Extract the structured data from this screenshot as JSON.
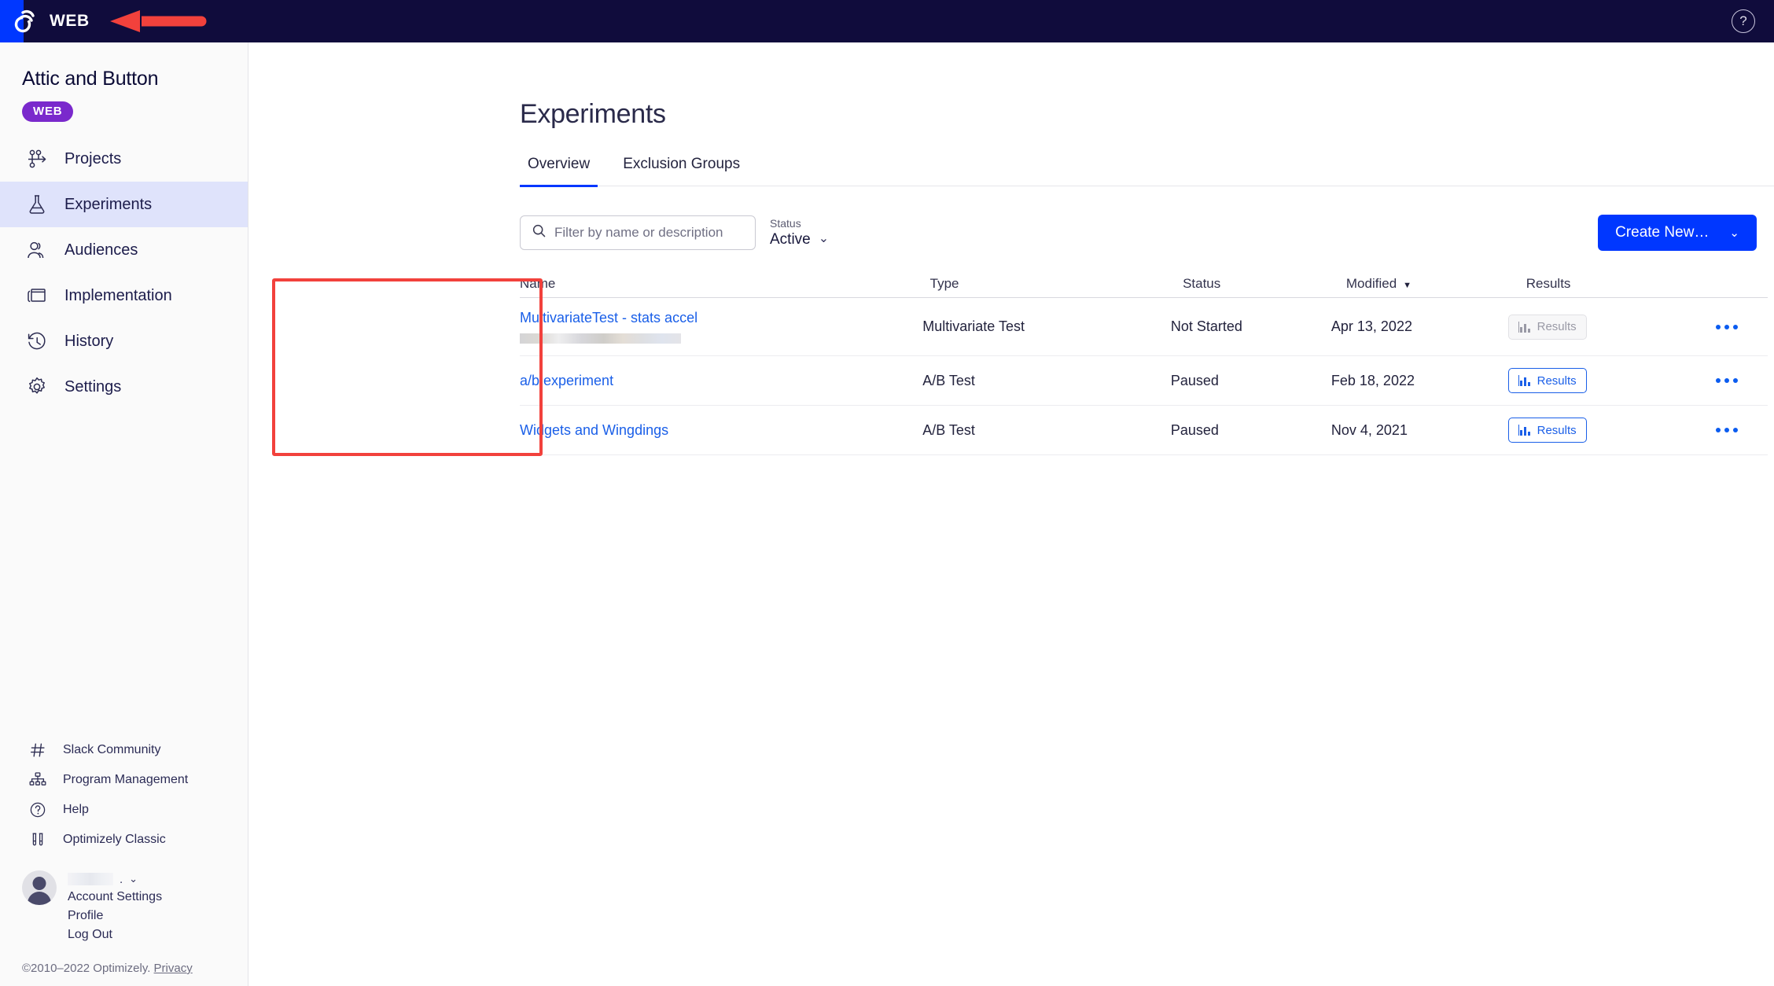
{
  "topbar": {
    "title": "WEB",
    "help_icon": "question-mark-circle-icon"
  },
  "sidebar": {
    "org_name": "Attic and Button",
    "badge": "WEB",
    "nav_items": [
      {
        "label": "Projects",
        "icon": "projects-branch-icon",
        "active": false
      },
      {
        "label": "Experiments",
        "icon": "flask-icon",
        "active": true
      },
      {
        "label": "Audiences",
        "icon": "people-icon",
        "active": false
      },
      {
        "label": "Implementation",
        "icon": "book-icon",
        "active": false
      },
      {
        "label": "History",
        "icon": "clock-undo-icon",
        "active": false
      },
      {
        "label": "Settings",
        "icon": "gear-icon",
        "active": false
      }
    ],
    "utility_items": [
      {
        "label": "Slack Community",
        "icon": "hash-icon"
      },
      {
        "label": "Program Management",
        "icon": "org-chart-icon"
      },
      {
        "label": "Help",
        "icon": "question-mark-circle-icon"
      },
      {
        "label": "Optimizely Classic",
        "icon": "test-tubes-icon"
      }
    ],
    "account": {
      "name_redacted": "",
      "name_suffix": ".",
      "links": [
        "Account Settings",
        "Profile",
        "Log Out"
      ]
    },
    "footer": {
      "copyright": "©2010–2022 Optimizely.",
      "privacy_link": "Privacy"
    }
  },
  "main": {
    "page_title": "Experiments",
    "tabs": [
      {
        "label": "Overview",
        "active": true
      },
      {
        "label": "Exclusion Groups",
        "active": false
      }
    ],
    "search": {
      "placeholder": "Filter by name or description",
      "value": ""
    },
    "status_filter": {
      "label": "Status",
      "value": "Active"
    },
    "create_button": {
      "label": "Create New…"
    },
    "table": {
      "headers": {
        "name": "Name",
        "type": "Type",
        "status": "Status",
        "modified": "Modified",
        "results": "Results"
      },
      "sort_column": "Modified",
      "sort_direction": "desc",
      "rows": [
        {
          "name": "MultivariateTest - stats accel",
          "has_description_redacted": true,
          "type": "Multivariate Test",
          "status": "Not Started",
          "modified": "Apr 13, 2022",
          "results_label": "Results",
          "results_enabled": false
        },
        {
          "name": "a/b experiment",
          "has_description_redacted": false,
          "type": "A/B Test",
          "status": "Paused",
          "modified": "Feb 18, 2022",
          "results_label": "Results",
          "results_enabled": true
        },
        {
          "name": "Widgets and Wingdings",
          "has_description_redacted": false,
          "type": "A/B Test",
          "status": "Paused",
          "modified": "Nov 4, 2021",
          "results_label": "Results",
          "results_enabled": true
        }
      ]
    }
  },
  "annotations": {
    "arrow_color": "#f2413c",
    "box_color": "#f2413c"
  }
}
